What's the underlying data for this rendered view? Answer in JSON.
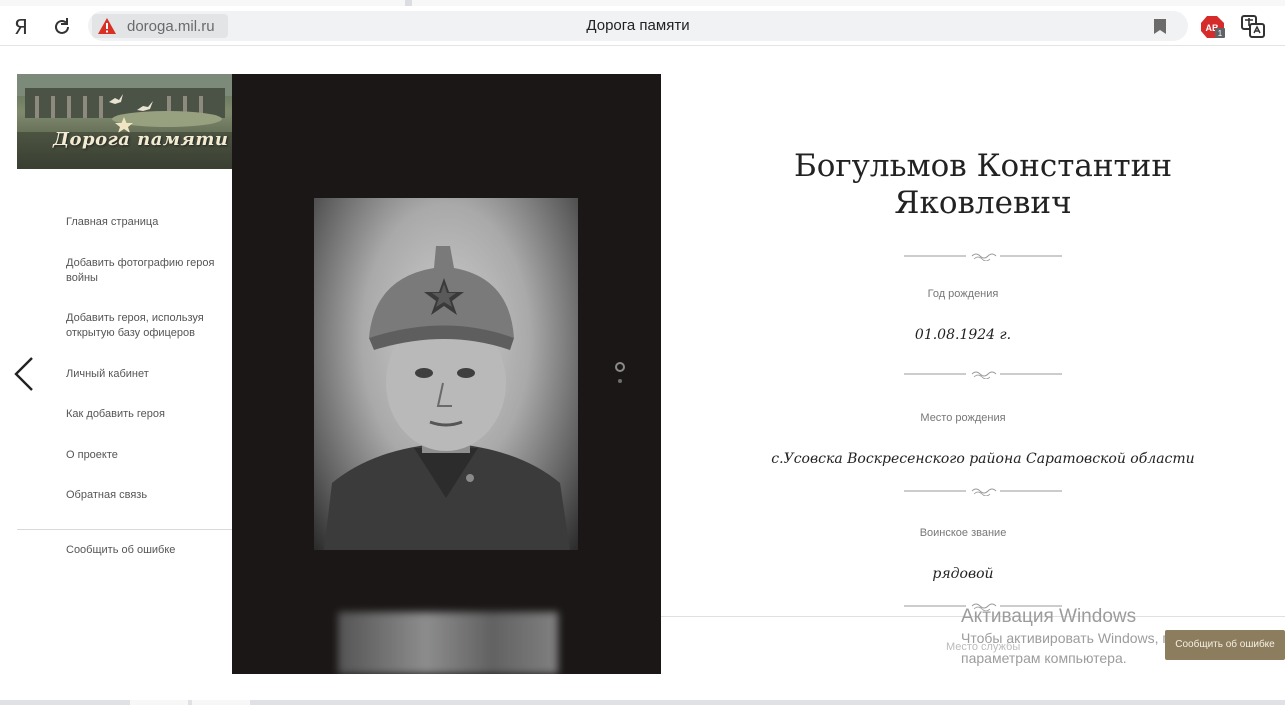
{
  "browser": {
    "logo": "Я",
    "domain": "dorogа.mil.ru",
    "page_title": "Дорога памяти"
  },
  "site": {
    "logo_text": "Дорога памяти",
    "menu": [
      "Главная страница",
      "Добавить фотографию героя войны",
      "Добавить героя, используя открытую базу офицеров",
      "Личный кабинет",
      "Как добавить героя",
      "О проекте",
      "Обратная связь"
    ],
    "report_error_link": "Сообщить об ошибке"
  },
  "hero": {
    "name": "Богульмов Константин Яковлевич",
    "fields": [
      {
        "label": "Год рождения",
        "value": "01.08.1924 г."
      },
      {
        "label": "Место рождения",
        "value": "с.Усовска Воскресенского района Саратовской области"
      },
      {
        "label": "Воинское звание",
        "value": "рядовой"
      }
    ],
    "next_field_label": "Место службы"
  },
  "report_button": "Сообщить об ошибке",
  "windows_activation": {
    "title": "Активация Windows",
    "line1": "Чтобы активировать Windows, перейдите к",
    "line2": "параметрам компьютера."
  },
  "icons": {
    "reload": "reload-icon",
    "warning": "warning-icon",
    "bookmark": "bookmark-icon",
    "adblock": "adblock-extension-icon",
    "translate": "translate-extension-icon",
    "prev": "chevron-left-icon"
  },
  "colors": {
    "photo_panel": "#1b1717",
    "report_button": "#8b7d5d",
    "warning": "#d93025"
  }
}
